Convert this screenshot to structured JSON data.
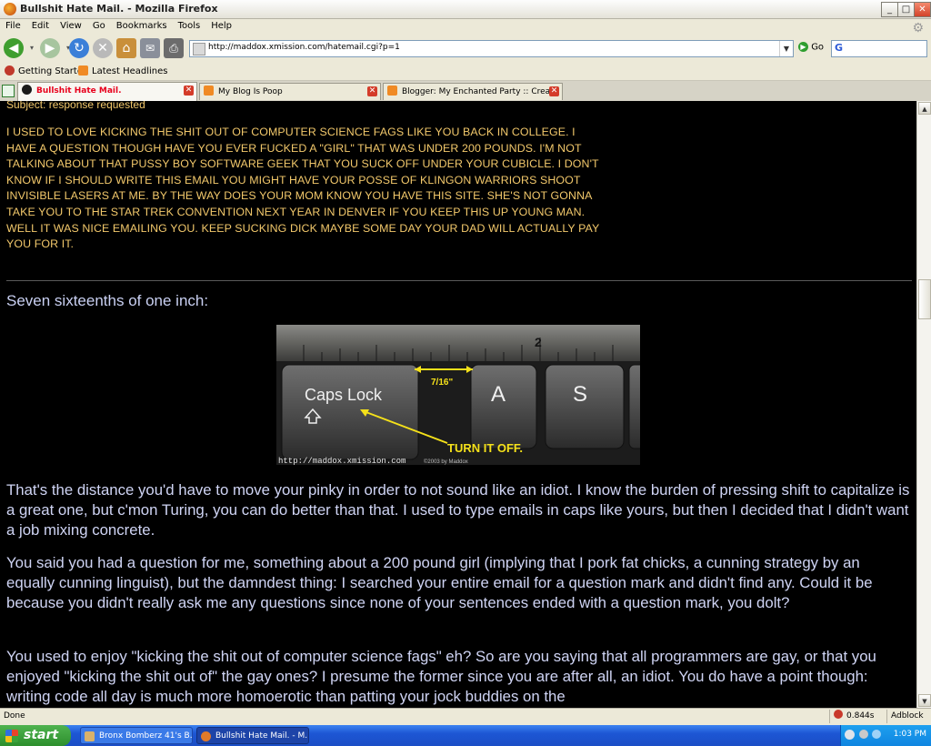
{
  "window": {
    "title": "Bullshit Hate Mail. - Mozilla Firefox",
    "controls": {
      "minimize": "_",
      "maximize": "□",
      "close": "✕"
    }
  },
  "menu": [
    "File",
    "Edit",
    "View",
    "Go",
    "Bookmarks",
    "Tools",
    "Help"
  ],
  "navbar": {
    "url": "http://maddox.xmission.com/hatemail.cgi?p=1",
    "go_label": "Go",
    "search_logo": "G"
  },
  "bookmarks": [
    "Getting Started",
    "Latest Headlines"
  ],
  "tabs": [
    {
      "label": "Bullshit Hate Mail.",
      "active": true
    },
    {
      "label": "My Blog Is Poop",
      "active": false
    },
    {
      "label": "Blogger: My Enchanted Party :: Crea...",
      "active": false
    }
  ],
  "page": {
    "subject": "Subject: response requested",
    "email_body": "I USED TO LOVE KICKING THE SHIT OUT OF COMPUTER SCIENCE FAGS LIKE YOU BACK IN COLLEGE. I HAVE A QUESTION THOUGH HAVE YOU EVER FUCKED A \"GIRL\" THAT WAS UNDER 200 POUNDS. I'M NOT TALKING ABOUT THAT PUSSY BOY SOFTWARE GEEK THAT YOU SUCK OFF UNDER YOUR CUBICLE. I DON'T KNOW IF I SHOULD WRITE THIS EMAIL YOU MIGHT HAVE YOUR POSSE OF KLINGON WARRIORS SHOOT INVISIBLE LASERS AT ME. BY THE WAY DOES YOUR MOM KNOW YOU HAVE THIS SITE. SHE'S NOT GONNA TAKE YOU TO THE STAR TREK CONVENTION NEXT YEAR IN DENVER IF YOU KEEP THIS UP YOUNG MAN. WELL IT WAS NICE EMAILING YOU. KEEP SUCKING DICK MAYBE SOME DAY YOUR DAD WILL ACTUALLY PAY YOU FOR IT.",
    "heading": "Seven sixteenths of one inch:",
    "image": {
      "ruler_mark": "2",
      "measure_label": "7/16\"",
      "key1": "Caps Lock",
      "key2": "A",
      "key3": "S",
      "arrow_label": "TURN IT OFF.",
      "credit_url": "http://maddox.xmission.com",
      "credit_copy": "©2003 by Maddox"
    },
    "paragraphs": [
      "That's the distance you'd have to move your pinky in order to not sound like an idiot. I know the burden of pressing shift to capitalize is a great one, but c'mon Turing, you can do better than that. I used to type emails in caps like yours, but then I decided that I didn't want a job mixing concrete.",
      "You said you had a question for me, something about a 200 pound girl (implying that I pork fat chicks, a cunning strategy by an equally cunning linguist), but the damndest thing: I searched your entire email for a question mark and didn't find any. Could it be because you didn't really ask me any questions since none of your sentences ended with a question mark, you dolt?",
      "You used to enjoy \"kicking the shit out of computer science fags\" eh? So are you saying that all programmers are gay, or that you enjoyed \"kicking the shit out of\" the gay ones? I presume the former since you are after all, an idiot. You do have a point though: writing code all day is much more homoerotic than patting your jock buddies on the"
    ]
  },
  "status": {
    "text": "Done",
    "timing": "0.844s",
    "adblock": "Adblock"
  },
  "taskbar": {
    "start": "start",
    "tasks": [
      "Bronx Bomberz 41's B...",
      "Bullshit Hate Mail. - M..."
    ],
    "clock": "1:03 PM"
  },
  "colors": {
    "email_text": "#f2c86b",
    "body_text": "#cfd4f4",
    "page_bg": "#000000",
    "active_tab_text": "#e8001c"
  }
}
